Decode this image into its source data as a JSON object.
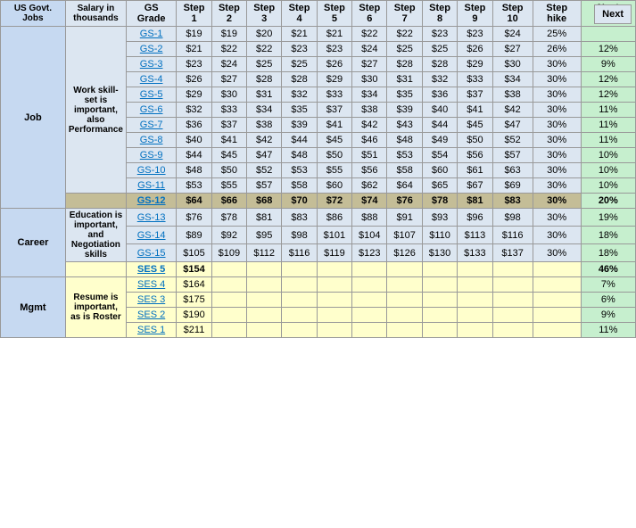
{
  "header": {
    "col1": "US Govt. Jobs",
    "col2": "Salary in thousands",
    "col3": "GS Grade",
    "steps": [
      "Step 1",
      "Step 2",
      "Step 3",
      "Step 4",
      "Step 5",
      "Step 6",
      "Step 7",
      "Step 8",
      "Step 9",
      "Step 10"
    ],
    "step_hike": "Step hike",
    "next_jump": "Next Jump"
  },
  "job_section": {
    "category": "Job",
    "description": "Work skill-set is important, also Performance",
    "rows": [
      {
        "grade": "GS-1",
        "s1": "$19",
        "s2": "$19",
        "s3": "$20",
        "s4": "$21",
        "s5": "$21",
        "s6": "$22",
        "s7": "$22",
        "s8": "$23",
        "s9": "$23",
        "s10": "$24",
        "hike": "25%",
        "jump": ""
      },
      {
        "grade": "GS-2",
        "s1": "$21",
        "s2": "$22",
        "s3": "$22",
        "s4": "$23",
        "s5": "$23",
        "s6": "$24",
        "s7": "$25",
        "s8": "$25",
        "s9": "$26",
        "s10": "$27",
        "hike": "26%",
        "jump": "12%"
      },
      {
        "grade": "GS-3",
        "s1": "$23",
        "s2": "$24",
        "s3": "$25",
        "s4": "$25",
        "s5": "$26",
        "s6": "$27",
        "s7": "$28",
        "s8": "$28",
        "s9": "$29",
        "s10": "$30",
        "hike": "30%",
        "jump": "9%"
      },
      {
        "grade": "GS-4",
        "s1": "$26",
        "s2": "$27",
        "s3": "$28",
        "s4": "$28",
        "s5": "$29",
        "s6": "$30",
        "s7": "$31",
        "s8": "$32",
        "s9": "$33",
        "s10": "$34",
        "hike": "30%",
        "jump": "12%"
      },
      {
        "grade": "GS-5",
        "s1": "$29",
        "s2": "$30",
        "s3": "$31",
        "s4": "$32",
        "s5": "$33",
        "s6": "$34",
        "s7": "$35",
        "s8": "$36",
        "s9": "$37",
        "s10": "$38",
        "hike": "30%",
        "jump": "12%"
      },
      {
        "grade": "GS-6",
        "s1": "$32",
        "s2": "$33",
        "s3": "$34",
        "s4": "$35",
        "s5": "$37",
        "s6": "$38",
        "s7": "$39",
        "s8": "$40",
        "s9": "$41",
        "s10": "$42",
        "hike": "30%",
        "jump": "11%"
      },
      {
        "grade": "GS-7",
        "s1": "$36",
        "s2": "$37",
        "s3": "$38",
        "s4": "$39",
        "s5": "$41",
        "s6": "$42",
        "s7": "$43",
        "s8": "$44",
        "s9": "$45",
        "s10": "$47",
        "hike": "30%",
        "jump": "11%"
      },
      {
        "grade": "GS-8",
        "s1": "$40",
        "s2": "$41",
        "s3": "$42",
        "s4": "$44",
        "s5": "$45",
        "s6": "$46",
        "s7": "$48",
        "s8": "$49",
        "s9": "$50",
        "s10": "$52",
        "hike": "30%",
        "jump": "11%"
      },
      {
        "grade": "GS-9",
        "s1": "$44",
        "s2": "$45",
        "s3": "$47",
        "s4": "$48",
        "s5": "$50",
        "s6": "$51",
        "s7": "$53",
        "s8": "$54",
        "s9": "$56",
        "s10": "$57",
        "hike": "30%",
        "jump": "10%"
      },
      {
        "grade": "GS-10",
        "s1": "$48",
        "s2": "$50",
        "s3": "$52",
        "s4": "$53",
        "s5": "$55",
        "s6": "$56",
        "s7": "$58",
        "s8": "$60",
        "s9": "$61",
        "s10": "$63",
        "hike": "30%",
        "jump": "10%"
      },
      {
        "grade": "GS-11",
        "s1": "$53",
        "s2": "$55",
        "s3": "$57",
        "s4": "$58",
        "s5": "$60",
        "s6": "$62",
        "s7": "$64",
        "s8": "$65",
        "s9": "$67",
        "s10": "$69",
        "hike": "30%",
        "jump": "10%"
      }
    ],
    "gs12": {
      "grade": "GS-12",
      "s1": "$64",
      "s2": "$66",
      "s3": "$68",
      "s4": "$70",
      "s5": "$72",
      "s6": "$74",
      "s7": "$76",
      "s8": "$78",
      "s9": "$81",
      "s10": "$83",
      "hike": "30%",
      "jump": "20%"
    }
  },
  "career_section": {
    "category": "Career",
    "description": "Education is important, and Negotiation skills",
    "rows": [
      {
        "grade": "GS-13",
        "s1": "$76",
        "s2": "$78",
        "s3": "$81",
        "s4": "$83",
        "s5": "$86",
        "s6": "$88",
        "s7": "$91",
        "s8": "$93",
        "s9": "$96",
        "s10": "$98",
        "hike": "30%",
        "jump": "19%"
      },
      {
        "grade": "GS-14",
        "s1": "$89",
        "s2": "$92",
        "s3": "$95",
        "s4": "$98",
        "s5": "$101",
        "s6": "$104",
        "s7": "$107",
        "s8": "$110",
        "s9": "$113",
        "s10": "$116",
        "hike": "30%",
        "jump": "18%"
      },
      {
        "grade": "GS-15",
        "s1": "$105",
        "s2": "$109",
        "s3": "$112",
        "s4": "$116",
        "s5": "$119",
        "s6": "$123",
        "s7": "$126",
        "s8": "$130",
        "s9": "$133",
        "s10": "$137",
        "hike": "30%",
        "jump": "18%"
      }
    ],
    "ses5": {
      "grade": "SES 5",
      "s1": "$154",
      "hike": "",
      "jump": "46%"
    }
  },
  "mgmt_section": {
    "category": "Mgmt",
    "description": "Resume is important, as is Roster",
    "rows": [
      {
        "grade": "SES 4",
        "s1": "$164",
        "hike": "",
        "jump": "7%"
      },
      {
        "grade": "SES 3",
        "s1": "$175",
        "hike": "",
        "jump": "6%"
      },
      {
        "grade": "SES 2",
        "s1": "$190",
        "hike": "",
        "jump": "9%"
      },
      {
        "grade": "SES 1",
        "s1": "$211",
        "hike": "",
        "jump": "11%"
      }
    ]
  },
  "next_button": "Next"
}
